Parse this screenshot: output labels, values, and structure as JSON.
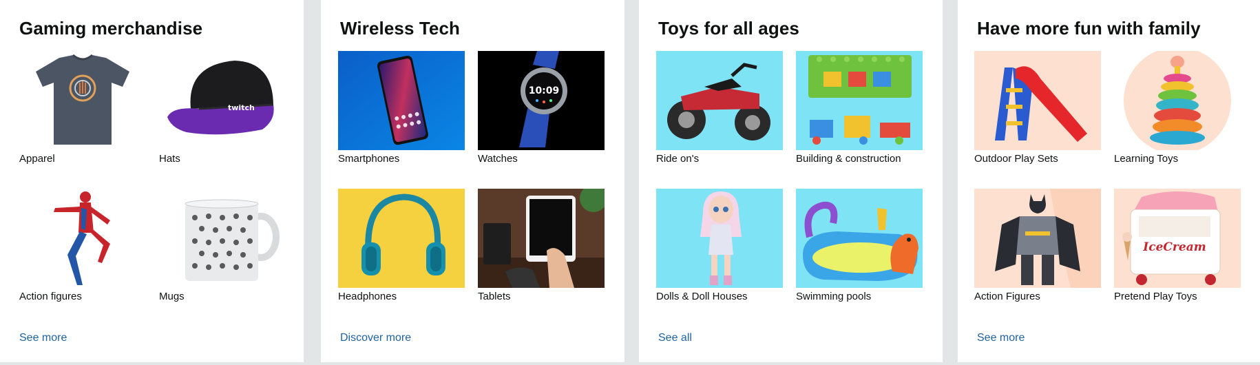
{
  "cards": [
    {
      "title": "Gaming merchandise",
      "tiles": [
        {
          "label": "Apparel",
          "image": "gray-atari-tshirt-image"
        },
        {
          "label": "Hats",
          "image": "black-purple-twitch-cap-image"
        },
        {
          "label": "Action figures",
          "image": "spiderman-figure-image"
        },
        {
          "label": "Mugs",
          "image": "patterned-mug-image"
        }
      ],
      "link": "See more",
      "logo_text": "twitch"
    },
    {
      "title": "Wireless Tech",
      "tiles": [
        {
          "label": "Smartphones",
          "image": "smartphone-image"
        },
        {
          "label": "Watches",
          "image": "smartwatch-image"
        },
        {
          "label": "Headphones",
          "image": "teal-headphones-image"
        },
        {
          "label": "Tablets",
          "image": "tablet-image"
        }
      ],
      "link": "Discover more",
      "watch_time": "10:09"
    },
    {
      "title": "Toys for all ages",
      "tiles": [
        {
          "label": "Ride on's",
          "image": "ride-on-atv-image"
        },
        {
          "label": "Building & construction",
          "image": "building-blocks-image"
        },
        {
          "label": "Dolls & Doll Houses",
          "image": "doll-image"
        },
        {
          "label": "Swimming pools",
          "image": "inflatable-pool-image"
        }
      ],
      "link": "See all"
    },
    {
      "title": "Have more fun with family",
      "tiles": [
        {
          "label": "Outdoor Play Sets",
          "image": "slide-image"
        },
        {
          "label": "Learning Toys",
          "image": "stacking-rings-image"
        },
        {
          "label": "Action Figures",
          "image": "batman-figure-image"
        },
        {
          "label": "Pretend Play Toys",
          "image": "ice-cream-cart-image"
        }
      ],
      "link": "See more",
      "cart_text": "IceCream"
    }
  ],
  "colors": {
    "page_background": "#e3e6e6",
    "card_background": "#ffffff",
    "link": "#2162a1",
    "text": "#0f1111",
    "toy_backdrop": "#7ee3f5",
    "family_backdrop": "#fde0cf"
  }
}
